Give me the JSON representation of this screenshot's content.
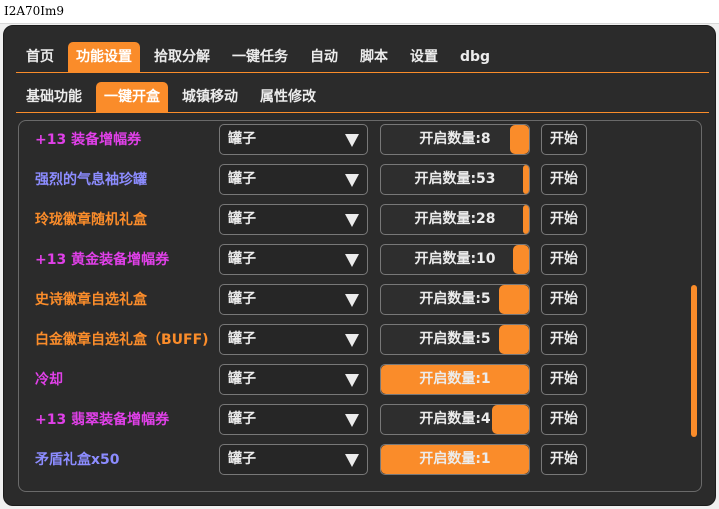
{
  "window": {
    "title": "I2A70Im9"
  },
  "colors": {
    "accent": "#fa8c2a",
    "magenta": "#e040e8",
    "blue": "#8c8cff",
    "orange": "#fa8c2a"
  },
  "tabs": [
    {
      "label": "首页",
      "active": false
    },
    {
      "label": "功能设置",
      "active": true
    },
    {
      "label": "拾取分解",
      "active": false
    },
    {
      "label": "一键任务",
      "active": false
    },
    {
      "label": "自动",
      "active": false
    },
    {
      "label": "脚本",
      "active": false
    },
    {
      "label": "设置",
      "active": false
    },
    {
      "label": "dbg",
      "active": false
    }
  ],
  "subtabs": [
    {
      "label": "基础功能",
      "active": false
    },
    {
      "label": "一键开盒",
      "active": true
    },
    {
      "label": "城镇移动",
      "active": false
    },
    {
      "label": "属性修改",
      "active": false
    }
  ],
  "rows": [
    {
      "name": "+13 装备增幅券",
      "color": "#e040e8",
      "select": "罐子",
      "slider_text": "开启数量:8",
      "slider_fill": 0.13,
      "button": "开始"
    },
    {
      "name": "强烈的气息袖珍罐",
      "color": "#8c8cff",
      "select": "罐子",
      "slider_text": "开启数量:53",
      "slider_fill": 0.04,
      "button": "开始"
    },
    {
      "name": "玲珑徽章随机礼盒",
      "color": "#fa8c2a",
      "select": "罐子",
      "slider_text": "开启数量:28",
      "slider_fill": 0.04,
      "button": "开始"
    },
    {
      "name": "+13 黄金装备增幅券",
      "color": "#e040e8",
      "select": "罐子",
      "slider_text": "开启数量:10",
      "slider_fill": 0.11,
      "button": "开始"
    },
    {
      "name": "史诗徽章自选礼盒",
      "color": "#fa8c2a",
      "select": "罐子",
      "slider_text": "开启数量:5",
      "slider_fill": 0.2,
      "button": "开始"
    },
    {
      "name": "白金徽章自选礼盒（BUFF)",
      "color": "#fa8c2a",
      "select": "罐子",
      "slider_text": "开启数量:5",
      "slider_fill": 0.2,
      "button": "开始"
    },
    {
      "name": "冷却",
      "color": "#e040e8",
      "select": "罐子",
      "slider_text": "开启数量:1",
      "slider_fill": 1.0,
      "button": "开始"
    },
    {
      "name": "+13 翡翠装备增幅券",
      "color": "#e040e8",
      "select": "罐子",
      "slider_text": "开启数量:4",
      "slider_fill": 0.25,
      "button": "开始"
    },
    {
      "name": "矛盾礼盒x50",
      "color": "#8c8cff",
      "select": "罐子",
      "slider_text": "开启数量:1",
      "slider_fill": 1.0,
      "button": "开始"
    }
  ],
  "icons": {
    "dropdown": "triangle-down-icon"
  }
}
